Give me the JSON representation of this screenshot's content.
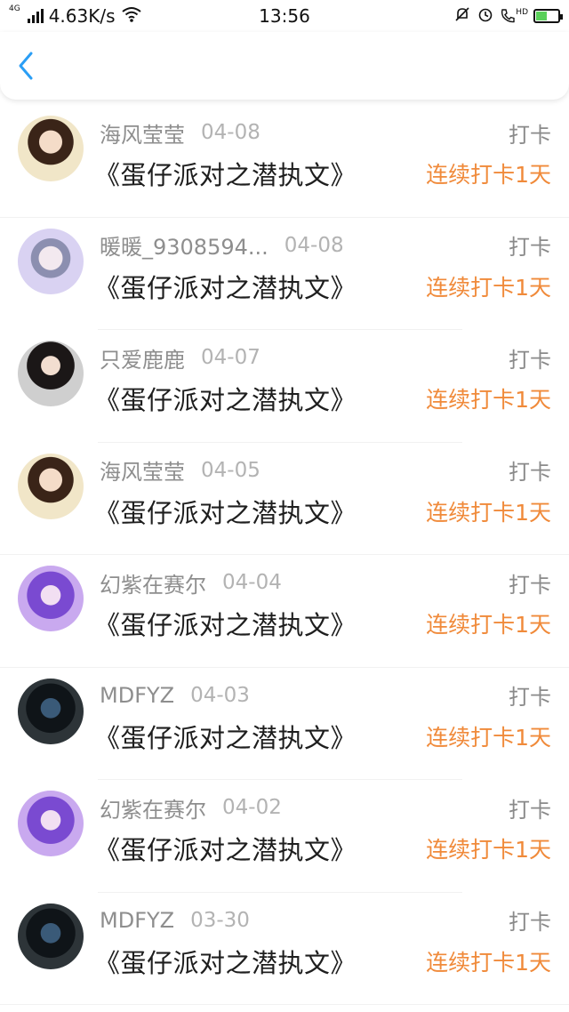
{
  "status_bar": {
    "network": "4G",
    "speed": "4.63K/s",
    "time": "13:56",
    "hd_label": "HD"
  },
  "nav": {
    "back_icon": "chevron-left-icon",
    "accent_color": "#2a9ef5"
  },
  "colors": {
    "streak": "#f08a3a",
    "muted": "#8e8e8e"
  },
  "entries": [
    {
      "user": "海风莹莹",
      "date": "04-08",
      "action": "打卡",
      "book": "《蛋仔派对之潜执文》",
      "streak": "连续打卡1天",
      "avatar": "girl"
    },
    {
      "user": "暖暖_9308594...",
      "date": "04-08",
      "action": "打卡",
      "book": "《蛋仔派对之潜执文》",
      "streak": "连续打卡1天",
      "avatar": "anime"
    },
    {
      "user": "只爱鹿鹿",
      "date": "04-07",
      "action": "打卡",
      "book": "《蛋仔派对之潜执文》",
      "streak": "连续打卡1天",
      "avatar": "dark"
    },
    {
      "user": "海风莹莹",
      "date": "04-05",
      "action": "打卡",
      "book": "《蛋仔派对之潜执文》",
      "streak": "连续打卡1天",
      "avatar": "girl"
    },
    {
      "user": "幻紫在赛尔",
      "date": "04-04",
      "action": "打卡",
      "book": "《蛋仔派对之潜执文》",
      "streak": "连续打卡1天",
      "avatar": "purple"
    },
    {
      "user": "MDFYZ",
      "date": "04-03",
      "action": "打卡",
      "book": "《蛋仔派对之潜执文》",
      "streak": "连续打卡1天",
      "avatar": "mask"
    },
    {
      "user": "幻紫在赛尔",
      "date": "04-02",
      "action": "打卡",
      "book": "《蛋仔派对之潜执文》",
      "streak": "连续打卡1天",
      "avatar": "purple"
    },
    {
      "user": "MDFYZ",
      "date": "03-30",
      "action": "打卡",
      "book": "《蛋仔派对之潜执文》",
      "streak": "连续打卡1天",
      "avatar": "mask"
    }
  ]
}
